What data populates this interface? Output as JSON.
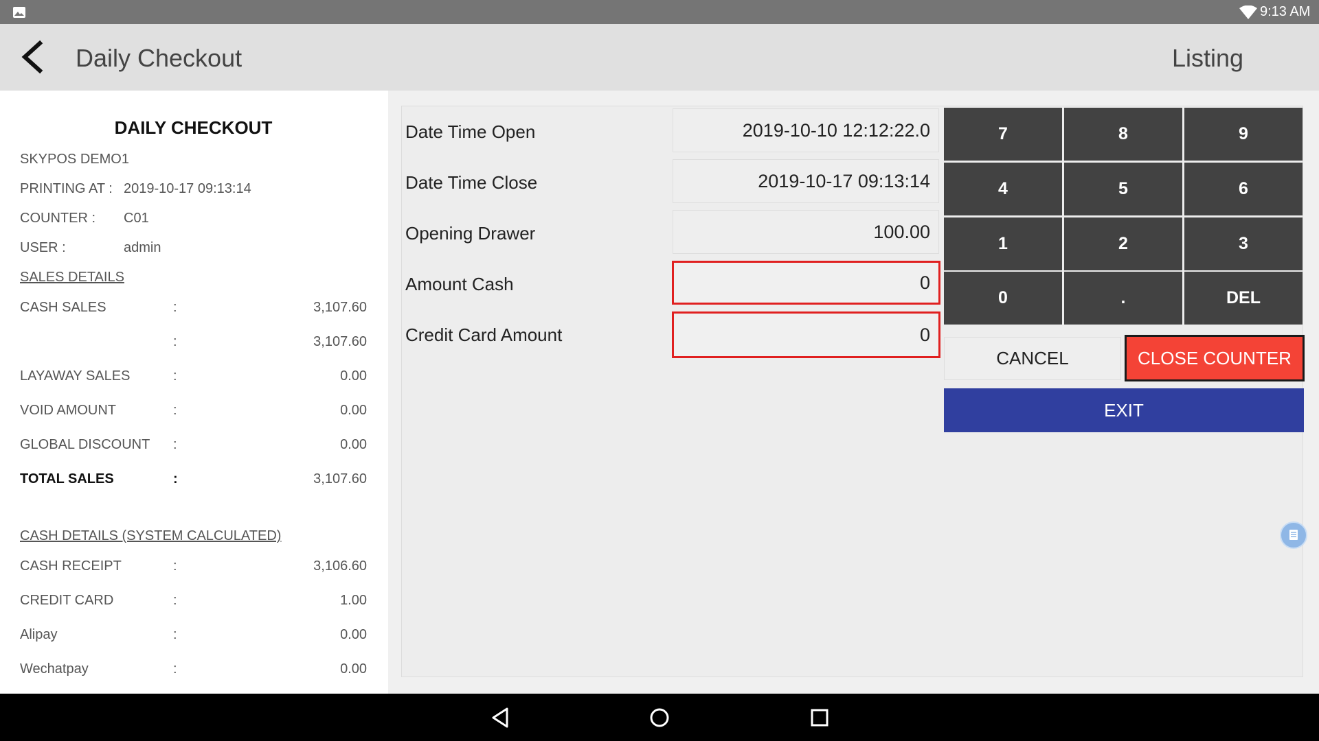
{
  "status_bar": {
    "time": "9:13 AM",
    "icons": [
      "image-icon",
      "wifi-icon"
    ]
  },
  "app_bar": {
    "title": "Daily Checkout",
    "back_icon": "arrow-back-icon",
    "action_label": "Listing"
  },
  "receipt": {
    "title": "DAILY CHECKOUT",
    "store": "SKYPOS DEMO1",
    "info": [
      {
        "label": "PRINTING AT :",
        "value": "2019-10-17 09:13:14"
      },
      {
        "label": "COUNTER :",
        "value": "C01"
      },
      {
        "label": "USER :",
        "value": "admin"
      }
    ],
    "sales_details_heading": "SALES DETAILS",
    "sales_rows": [
      {
        "label": "CASH SALES",
        "colon": ":",
        "amount": "3,107.60"
      },
      {
        "label": "",
        "colon": ":",
        "amount": "3,107.60"
      },
      {
        "label": "LAYAWAY SALES",
        "colon": ":",
        "amount": "0.00"
      },
      {
        "label": "VOID AMOUNT",
        "colon": ":",
        "amount": "0.00"
      },
      {
        "label": "GLOBAL DISCOUNT",
        "colon": ":",
        "amount": "0.00"
      },
      {
        "label": "TOTAL SALES",
        "colon": ":",
        "amount": "3,107.60"
      }
    ],
    "cash_details_heading": "CASH DETAILS (SYSTEM CALCULATED)",
    "cash_rows": [
      {
        "label": "CASH RECEIPT",
        "colon": ":",
        "amount": "3,106.60"
      },
      {
        "label": "CREDIT CARD",
        "colon": ":",
        "amount": "1.00"
      },
      {
        "label": "Alipay",
        "colon": ":",
        "amount": "0.00"
      },
      {
        "label": "Wechatpay",
        "colon": ":",
        "amount": "0.00"
      }
    ]
  },
  "form": {
    "date_time_open": {
      "label": "Date Time Open",
      "value": "2019-10-10 12:12:22.0"
    },
    "date_time_close": {
      "label": "Date Time Close",
      "value": "2019-10-17 09:13:14"
    },
    "opening_drawer": {
      "label": "Opening Drawer",
      "value": "100.00"
    },
    "amount_cash": {
      "label": "Amount Cash",
      "value": "0"
    },
    "credit_card_amount": {
      "label": "Credit Card Amount",
      "value": "0"
    }
  },
  "keypad": {
    "keys": [
      "7",
      "8",
      "9",
      "4",
      "5",
      "6",
      "1",
      "2",
      "3",
      "0",
      ".",
      "DEL"
    ]
  },
  "actions": {
    "cancel": "CANCEL",
    "close_counter": "CLOSE COUNTER",
    "exit": "EXIT"
  },
  "colors": {
    "keypad": "#424242",
    "close_counter": "#f44336",
    "exit": "#303f9f",
    "input_border": "#e02020"
  },
  "nav_bar": {
    "icons": [
      "back-triangle-icon",
      "home-circle-icon",
      "recents-square-icon"
    ]
  }
}
